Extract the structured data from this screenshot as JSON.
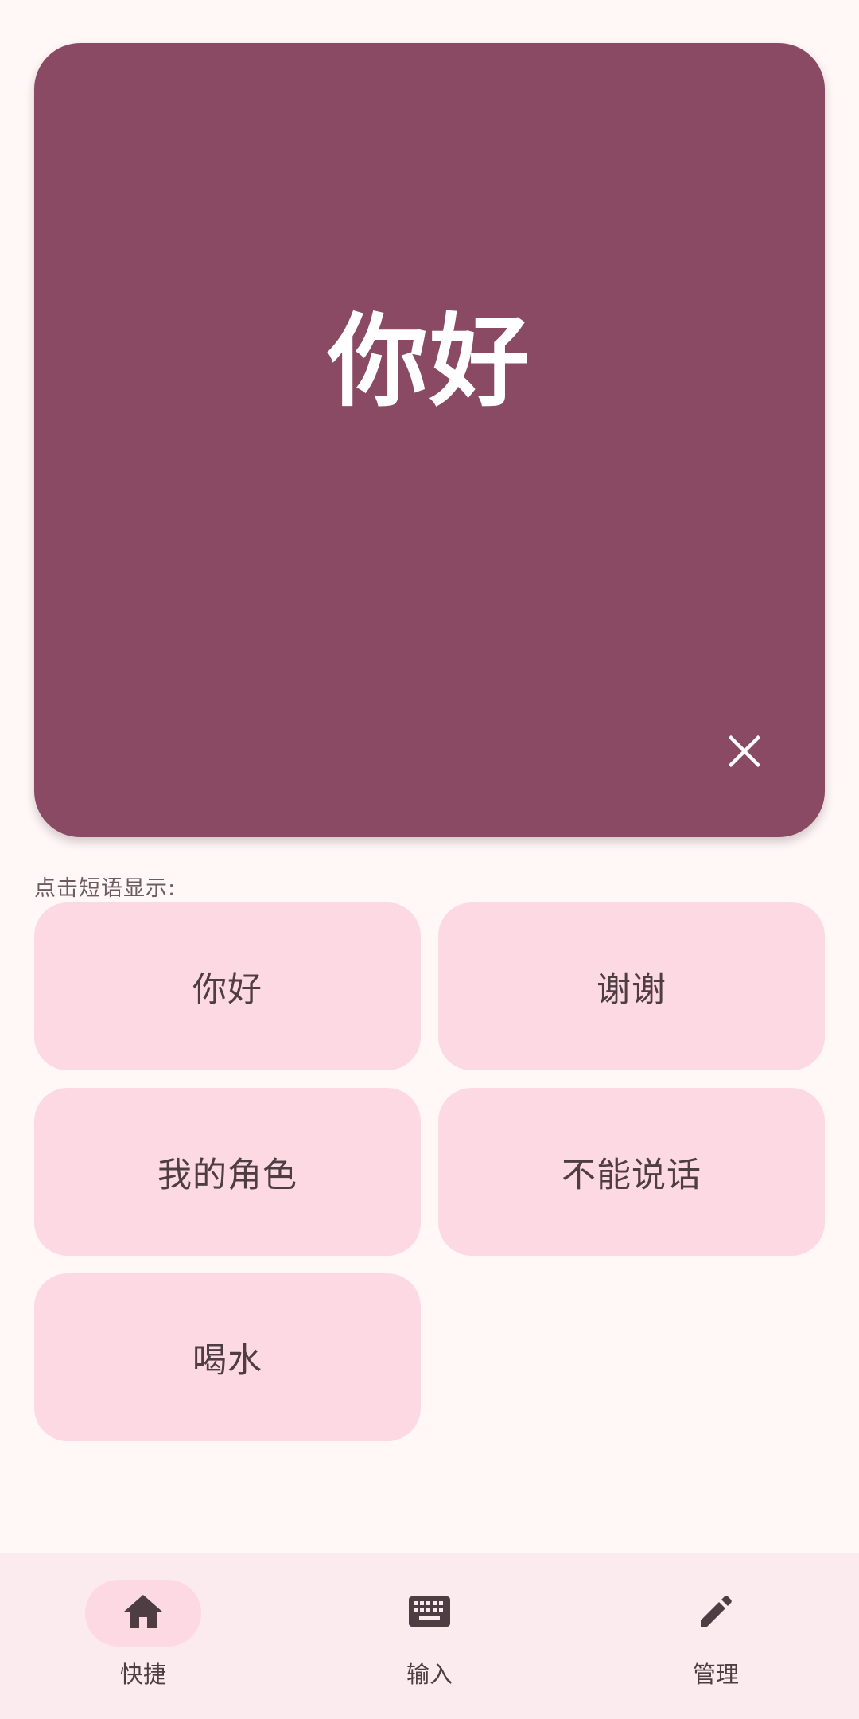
{
  "display": {
    "text": "你好",
    "close_icon": "close-icon",
    "background_color": "#8B4A63"
  },
  "hint": "点击短语显示:",
  "phrases": [
    {
      "label": "你好"
    },
    {
      "label": "谢谢"
    },
    {
      "label": "我的角色"
    },
    {
      "label": "不能说话"
    },
    {
      "label": "喝水"
    }
  ],
  "nav": {
    "items": [
      {
        "label": "快捷",
        "icon": "home-icon",
        "active": true
      },
      {
        "label": "输入",
        "icon": "keyboard-icon",
        "active": false
      },
      {
        "label": "管理",
        "icon": "edit-icon",
        "active": false
      }
    ]
  },
  "colors": {
    "accent": "#8B4A63",
    "chip": "#FDD9E4",
    "nav_background": "#FBEAEE"
  }
}
